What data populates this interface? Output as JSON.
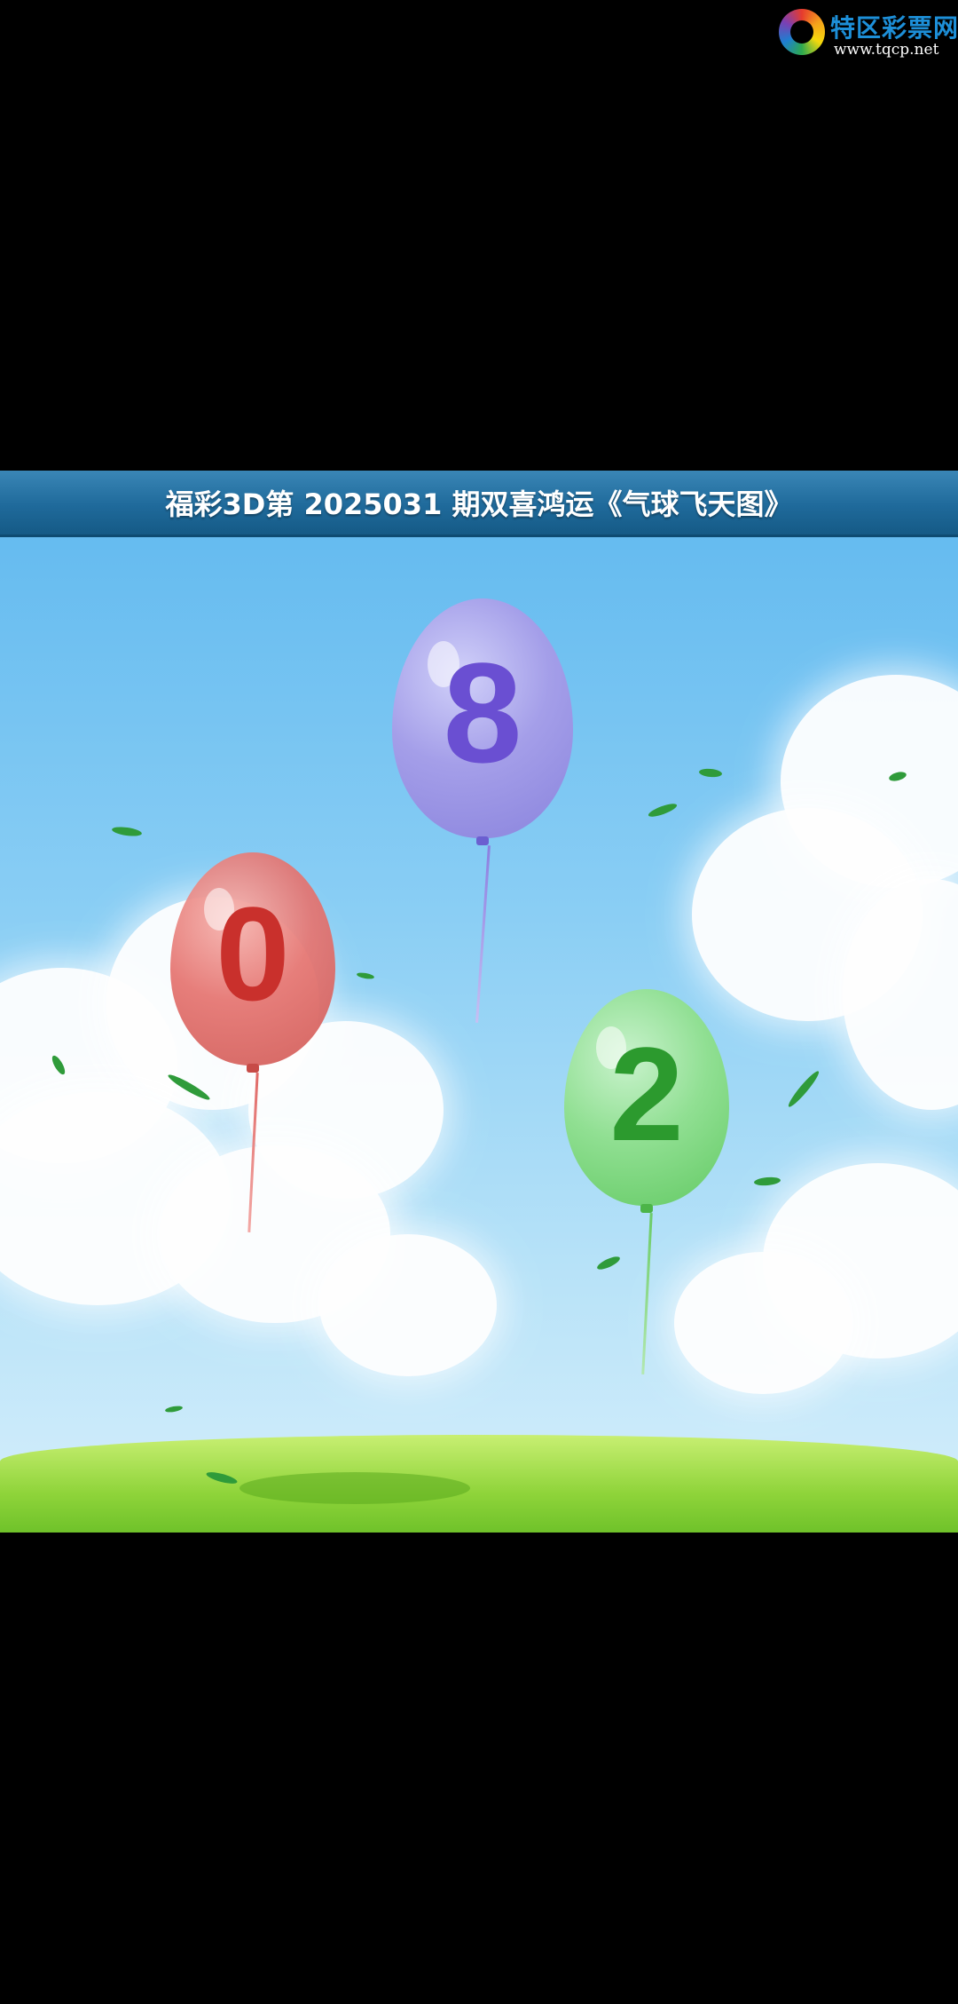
{
  "watermark": {
    "name": "特区彩票网",
    "url": "www.tqcp.net"
  },
  "banner": {
    "title": "福彩3D第 2025031 期双喜鸿运《气球飞天图》"
  },
  "balloons": [
    {
      "digit": "0",
      "color": "#e5736f",
      "digit_color": "#c9302c"
    },
    {
      "digit": "8",
      "color": "#a89be8",
      "digit_color": "#6a4fd2"
    },
    {
      "digit": "2",
      "color": "#8fe08a",
      "digit_color": "#2c9a2e"
    }
  ]
}
